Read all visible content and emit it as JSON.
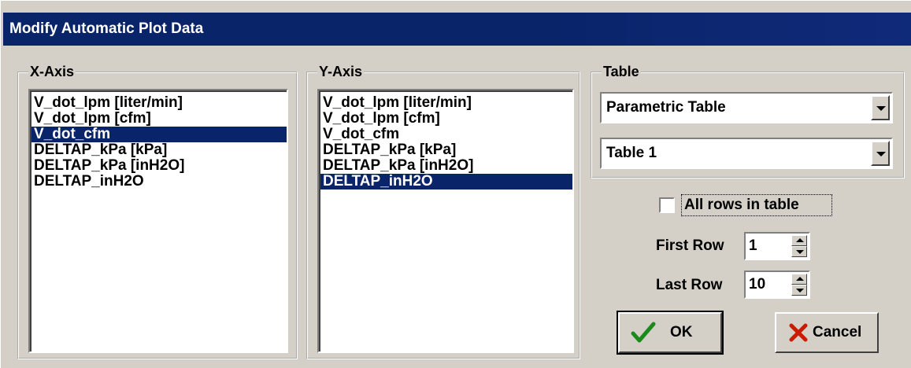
{
  "window": {
    "title": "Modify Automatic Plot Data"
  },
  "x_axis": {
    "title": "X-Axis",
    "items": [
      "V_dot_lpm [liter/min]",
      "V_dot_lpm [cfm]",
      "V_dot_cfm",
      "DELTAP_kPa [kPa]",
      "DELTAP_kPa [inH2O]",
      "DELTAP_inH2O"
    ],
    "selected": "V_dot_cfm"
  },
  "y_axis": {
    "title": "Y-Axis",
    "items": [
      "V_dot_lpm [liter/min]",
      "V_dot_lpm [cfm]",
      "V_dot_cfm",
      "DELTAP_kPa [kPa]",
      "DELTAP_kPa [inH2O]",
      "DELTAP_inH2O"
    ],
    "selected": "DELTAP_inH2O"
  },
  "table": {
    "title": "Table",
    "type_value": "Parametric Table",
    "table_value": "Table 1"
  },
  "rows": {
    "all_rows_label": "All rows in table",
    "all_rows_checked": false,
    "first_row_label": "First Row",
    "first_row_value": "1",
    "last_row_label": "Last Row",
    "last_row_value": "10"
  },
  "buttons": {
    "ok": "OK",
    "cancel": "Cancel"
  },
  "colors": {
    "selection": "#0a246a",
    "ok_check": "#1a8a1a",
    "cancel_x": "#cc1a00"
  }
}
